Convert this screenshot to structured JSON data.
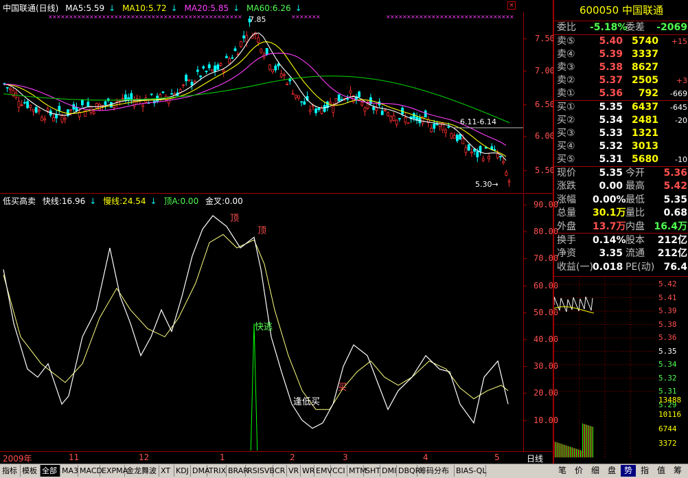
{
  "stock": {
    "code": "600050",
    "name": "中国联通"
  },
  "main_legend": {
    "title": "中国联通(日线)",
    "ma5": "MA5:5.59",
    "ma10": "MA10:5.72",
    "ma20": "MA20:5.85",
    "ma60": "MA60:6.26"
  },
  "annotations": {
    "high": "7.85",
    "low": "5.30",
    "range": "6.11-6.14"
  },
  "price_axis": [
    "7.50",
    "7.00",
    "6.50",
    "6.00",
    "5.50"
  ],
  "indicator_legend": {
    "name": "低买高卖",
    "fast": "快线:16.96",
    "slow": "慢线:24.54",
    "top": "顶A:0.00",
    "cross": "金叉:0.00"
  },
  "indicator_axis": [
    "90.00",
    "80.00",
    "70.00",
    "60.00",
    "50.00",
    "40.00",
    "30.00",
    "20.00",
    "10.00"
  ],
  "indicator_marks": {
    "top1": "顶",
    "top2": "顶",
    "escape": "快逃",
    "buy_low": "逢低买",
    "buy": "买"
  },
  "date_axis": {
    "year": "2009年",
    "months": [
      "11",
      "12",
      "1",
      "2",
      "3",
      "4",
      "5"
    ],
    "period": "日线"
  },
  "quote": {
    "wei_bi_label": "委比",
    "wei_bi": "-5.18%",
    "wei_cha_label": "委差",
    "wei_cha": "-2069",
    "sells": [
      {
        "label": "卖⑤",
        "price": "5.40",
        "vol": "5740",
        "chg": "+15"
      },
      {
        "label": "卖④",
        "price": "5.39",
        "vol": "3337",
        "chg": ""
      },
      {
        "label": "卖③",
        "price": "5.38",
        "vol": "8627",
        "chg": ""
      },
      {
        "label": "卖②",
        "price": "5.37",
        "vol": "2505",
        "chg": "+3"
      },
      {
        "label": "卖①",
        "price": "5.36",
        "vol": "792",
        "chg": "-669"
      }
    ],
    "buys": [
      {
        "label": "买①",
        "price": "5.35",
        "vol": "6437",
        "chg": "-645"
      },
      {
        "label": "买②",
        "price": "5.34",
        "vol": "2481",
        "chg": "-20"
      },
      {
        "label": "买③",
        "price": "5.33",
        "vol": "1321",
        "chg": ""
      },
      {
        "label": "买④",
        "price": "5.32",
        "vol": "3013",
        "chg": ""
      },
      {
        "label": "买⑤",
        "price": "5.31",
        "vol": "5680",
        "chg": "-10"
      }
    ],
    "stats": [
      {
        "l1": "现价",
        "v1": "5.35",
        "l2": "今开",
        "v2": "5.36",
        "c1": "white",
        "c2": "red"
      },
      {
        "l1": "涨跌",
        "v1": "0.00",
        "l2": "最高",
        "v2": "5.42",
        "c1": "white",
        "c2": "red"
      },
      {
        "l1": "涨幅",
        "v1": "0.00%",
        "l2": "最低",
        "v2": "5.35",
        "c1": "white",
        "c2": "white"
      },
      {
        "l1": "总量",
        "v1": "30.1万",
        "l2": "量比",
        "v2": "0.68",
        "c1": "yellow",
        "c2": "white"
      },
      {
        "l1": "外盘",
        "v1": "13.7万",
        "l2": "内盘",
        "v2": "16.4万",
        "c1": "red",
        "c2": "green"
      }
    ],
    "stats2": [
      {
        "l1": "换手",
        "v1": "0.14%",
        "l2": "股本",
        "v2": "212亿"
      },
      {
        "l1": "净资",
        "v1": "3.35",
        "l2": "流通",
        "v2": "212亿"
      },
      {
        "l1": "收益(一)",
        "v1": "0.018",
        "l2": "PE(动)",
        "v2": "76.4"
      }
    ]
  },
  "mini_price_axis": [
    "5.42",
    "5.41",
    "5.39",
    "5.38",
    "5.36",
    "5.35",
    "5.34",
    "5.32",
    "5.31",
    "5.29"
  ],
  "mini_vol_axis": [
    "13488",
    "10116",
    "6744",
    "3372"
  ],
  "bottom_tabs": [
    "指标",
    "模板",
    "全部",
    "MA3",
    "MACD",
    "EXPMA",
    "金龙舞波",
    "XT",
    "KDJ",
    "DMA",
    "TRIX",
    "BRAR",
    "RSISVB",
    "CR",
    "VR",
    "WR",
    "EMV",
    "CCI",
    "MTM",
    "SHT",
    "DMI",
    "DBQR",
    "筹码分布",
    "BIAS-QL"
  ],
  "right_tabs": [
    "笔",
    "价",
    "细",
    "盘",
    "势",
    "指",
    "值",
    "筹"
  ],
  "colors": {
    "up": "#ff3030",
    "down": "#00ffff",
    "ma5": "#ffffff",
    "ma10": "#ffff00",
    "ma20": "#ff40ff",
    "ma60": "#00c000",
    "bg": "#000000",
    "grid": "#a00000"
  }
}
